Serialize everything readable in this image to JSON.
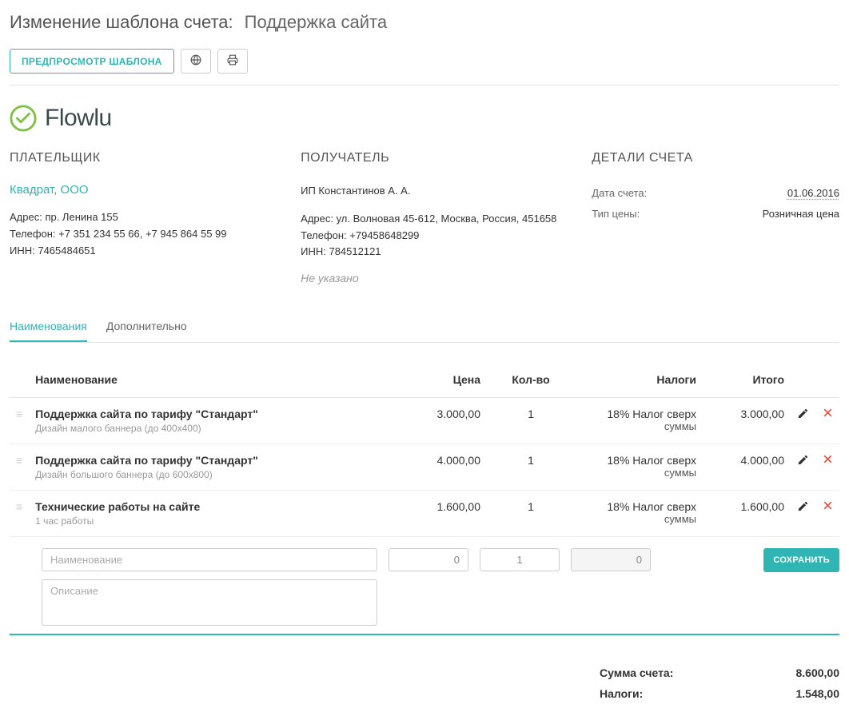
{
  "header": {
    "label": "Изменение шаблона счета:",
    "value": "Поддержка сайта"
  },
  "toolbar": {
    "preview_label": "ПРЕДПРОСМОТР ШАБЛОНА"
  },
  "logo": {
    "text": "Flowlu"
  },
  "payer": {
    "title": "ПЛАТЕЛЬЩИК",
    "name": "Квадрат, ООО",
    "address": "Адрес: пр. Ленина 155",
    "phone": "Телефон: +7 351 234 55 66, +7 945 864 55 99",
    "inn": "ИНН: 7465484651"
  },
  "recipient": {
    "title": "ПОЛУЧАТЕЛЬ",
    "name": "ИП Константинов А. А.",
    "address": "Адрес: ул. Волновая 45-612, Москва, Россия, 451658",
    "phone": "Телефон: +79458648299",
    "inn": "ИНН: 784512121",
    "not_specified": "Не указано"
  },
  "details": {
    "title": "ДЕТАЛИ СЧЕТА",
    "date_label": "Дата счета:",
    "date_value": "01.06.2016",
    "price_type_label": "Тип цены:",
    "price_type_value": "Розничная цена"
  },
  "tabs": {
    "names": "Наименования",
    "extra": "Дополнительно"
  },
  "table": {
    "headers": {
      "name": "Наименование",
      "price": "Цена",
      "qty": "Кол-во",
      "tax": "Налоги",
      "total": "Итого"
    },
    "rows": [
      {
        "title": "Поддержка сайта по тарифу \"Стандарт\"",
        "desc": "Дизайн малого баннера (до 400х400)",
        "price": "3.000,00",
        "qty": "1",
        "tax_pct": "18%",
        "tax_kind": "Налог сверх суммы",
        "total": "3.000,00"
      },
      {
        "title": "Поддержка сайта по тарифу \"Стандарт\"",
        "desc": "Дизайн большого баннера (до 600х800)",
        "price": "4.000,00",
        "qty": "1",
        "tax_pct": "18%",
        "tax_kind": "Налог сверх суммы",
        "total": "4.000,00"
      },
      {
        "title": "Технические работы на сайте",
        "desc": "1 час работы",
        "price": "1.600,00",
        "qty": "1",
        "tax_pct": "18%",
        "tax_kind": "Налог сверх суммы",
        "total": "1.600,00"
      }
    ]
  },
  "new_row": {
    "name_placeholder": "Наименование",
    "desc_placeholder": "Описание",
    "price_value": "0",
    "qty_value": "1",
    "total_value": "0",
    "save_label": "СОХРАНИТЬ"
  },
  "totals": {
    "sum_label": "Сумма счета:",
    "sum_value": "8.600,00",
    "tax_label": "Налоги:",
    "tax_value": "1.548,00"
  }
}
